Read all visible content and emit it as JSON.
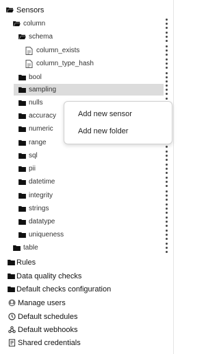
{
  "tree": {
    "root": {
      "label": "Sensors",
      "icon": "folder-open-icon"
    },
    "column": {
      "label": "column",
      "icon": "folder-open-icon"
    },
    "schema": {
      "label": "schema",
      "icon": "folder-open-icon"
    },
    "files": [
      {
        "label": "column_exists",
        "icon": "document-icon"
      },
      {
        "label": "column_type_hash",
        "icon": "document-icon"
      }
    ],
    "folders": [
      {
        "label": "bool"
      },
      {
        "label": "sampling"
      },
      {
        "label": "nulls"
      },
      {
        "label": "accuracy"
      },
      {
        "label": "numeric"
      },
      {
        "label": "range"
      },
      {
        "label": "sql"
      },
      {
        "label": "pii"
      },
      {
        "label": "datetime"
      },
      {
        "label": "integrity"
      },
      {
        "label": "strings"
      },
      {
        "label": "datatype"
      },
      {
        "label": "uniqueness"
      }
    ],
    "table": {
      "label": "table"
    }
  },
  "sections": [
    {
      "label": "Rules",
      "icon": "folder-icon"
    },
    {
      "label": "Data quality checks",
      "icon": "folder-icon"
    },
    {
      "label": "Default checks configuration",
      "icon": "folder-icon"
    },
    {
      "label": "Manage users",
      "icon": "user-icon"
    },
    {
      "label": "Default schedules",
      "icon": "clock-icon"
    },
    {
      "label": "Default webhooks",
      "icon": "webhook-icon"
    },
    {
      "label": "Shared credentials",
      "icon": "credentials-icon"
    }
  ],
  "context_menu": {
    "items": [
      "Add new sensor",
      "Add new folder"
    ]
  }
}
